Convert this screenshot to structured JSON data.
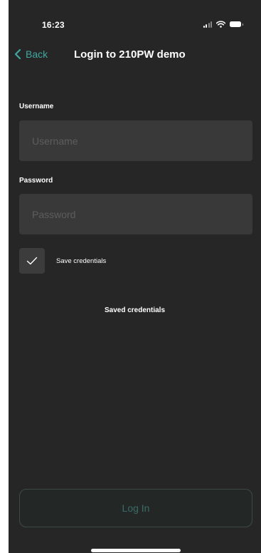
{
  "status_bar": {
    "time": "16:23",
    "icons": [
      "signal-icon",
      "wifi-icon",
      "battery-icon"
    ]
  },
  "nav": {
    "back_label": "Back",
    "title": "Login to 210PW demo"
  },
  "form": {
    "username": {
      "label": "Username",
      "placeholder": "Username",
      "value": ""
    },
    "password": {
      "label": "Password",
      "placeholder": "Password",
      "value": ""
    },
    "save_credentials": {
      "label": "Save credentials",
      "checked": true
    }
  },
  "saved_credentials": {
    "heading": "Saved credentials"
  },
  "login_button": {
    "label": "Log In"
  },
  "colors": {
    "background": "#262626",
    "input_background": "#393939",
    "accent": "#3fa8a2",
    "login_button_text": "#3b6b66"
  }
}
